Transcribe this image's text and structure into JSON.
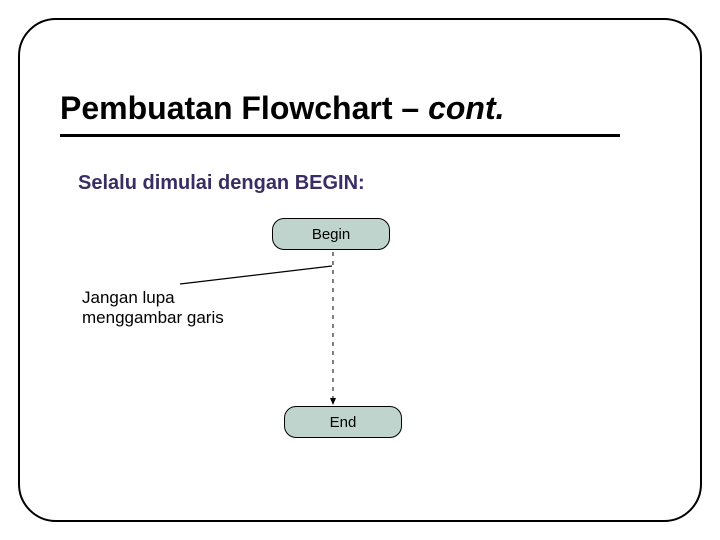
{
  "title": {
    "main": "Pembuatan Flowchart – ",
    "cont": "cont."
  },
  "subtitle": "Selalu dimulai dengan BEGIN:",
  "flow": {
    "begin_label": "Begin",
    "end_label": "End"
  },
  "note": {
    "line1": "Jangan lupa",
    "line2": "menggambar garis"
  },
  "colors": {
    "terminator_fill": "#bfd4cd",
    "subtitle_color": "#3a2d63"
  }
}
